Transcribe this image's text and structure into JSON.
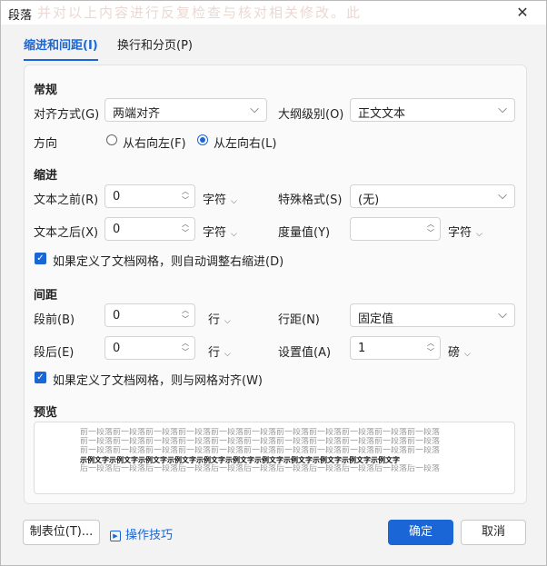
{
  "window": {
    "title": "段落",
    "background_text": "并对以上内容进行反复检查与核对相关修改。此",
    "close_symbol": "✕"
  },
  "tabs": [
    {
      "label": "缩进和间距(I)",
      "active": true
    },
    {
      "label": "换行和分页(P)",
      "active": false
    }
  ],
  "general": {
    "heading": "常规",
    "alignment_label": "对齐方式(G)",
    "alignment_value": "两端对齐",
    "outline_label": "大纲级别(O)",
    "outline_value": "正文文本",
    "direction_label": "方向",
    "rtl_label": "从右向左(F)",
    "ltr_label": "从左向右(L)",
    "direction_selected": "ltr"
  },
  "indent": {
    "heading": "缩进",
    "before_label": "文本之前(R)",
    "before_value": "0",
    "before_unit": "字符",
    "special_label": "特殊格式(S)",
    "special_value": "(无)",
    "after_label": "文本之后(X)",
    "after_value": "0",
    "after_unit": "字符",
    "measure_label": "度量值(Y)",
    "measure_value": "",
    "measure_unit": "字符",
    "auto_adjust_label": "如果定义了文档网格，则自动调整右缩进(D)",
    "auto_adjust_checked": true
  },
  "spacing": {
    "heading": "间距",
    "before_label": "段前(B)",
    "before_value": "0",
    "before_unit": "行",
    "line_label": "行距(N)",
    "line_value": "固定值",
    "after_label": "段后(E)",
    "after_value": "0",
    "after_unit": "行",
    "setting_label": "设置值(A)",
    "setting_value": "1",
    "setting_unit": "磅",
    "snap_label": "如果定义了文档网格，则与网格对齐(W)",
    "snap_checked": true
  },
  "preview": {
    "heading": "预览",
    "lines": [
      "前一段落前一段落前一段落前一段落前一段落前一段落前一段落前一段落前一段落前一段落前一段落",
      "前一段落前一段落前一段落前一段落前一段落前一段落前一段落前一段落前一段落前一段落前一段落",
      "前一段落前一段落前一段落前一段落前一段落前一段落前一段落前一段落前一段落前一段落前一段落",
      "示例文字示例文字示例文字示例文字示例文字示例文字示例文字示例文字示例文字示例文字示例文字",
      "后一段落后一段落后一段落后一段落后一段落后一段落后一段落后一段落后一段落后一段落后一段落"
    ]
  },
  "footer": {
    "tabs_button": "制表位(T)...",
    "tips_link": "操作技巧",
    "ok_button": "确定",
    "cancel_button": "取消"
  },
  "colors": {
    "accent": "#1a66d6",
    "background": "#f3f3f3",
    "panel": "#fafafa"
  },
  "icons": {
    "close": "close-icon",
    "dropdown": "chevron-down-icon",
    "spinner_up": "chevron-up-icon",
    "spinner_down": "chevron-down-icon",
    "check": "check-icon",
    "tips": "play-icon"
  }
}
